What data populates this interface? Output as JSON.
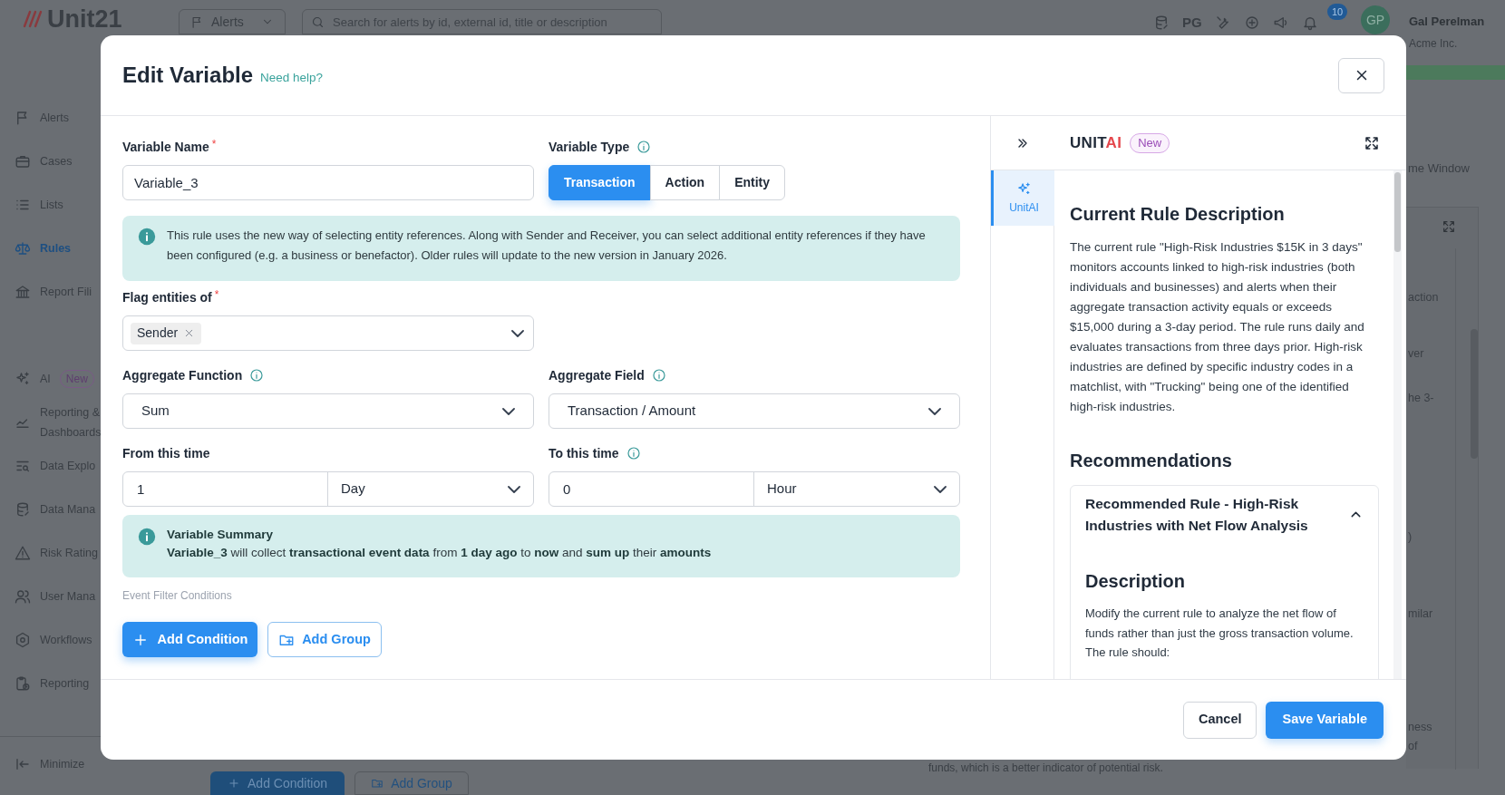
{
  "app": {
    "logo": "Unit21",
    "module_menu": "Alerts",
    "search": {
      "placeholder": "Search for alerts by id, external id, title or description"
    },
    "env_label": "PG",
    "notification_count": "10",
    "avatar_initials": "GP",
    "user_name": "Gal Perelman",
    "org": "Acme Inc."
  },
  "sidebar": {
    "groups": [
      [
        {
          "label": "Alerts",
          "selected": false
        },
        {
          "label": "Cases",
          "selected": false
        },
        {
          "label": "Lists",
          "selected": false
        },
        {
          "label": "Rules",
          "selected": true
        },
        {
          "label": "Report Fili",
          "selected": false
        }
      ],
      [
        {
          "label": "AI",
          "badge": "New",
          "selected": false
        },
        {
          "label": "Reporting & Dashboards",
          "selected": false
        },
        {
          "label": "Data Explo",
          "selected": false
        },
        {
          "label": "Data Mana",
          "selected": false
        },
        {
          "label": "Risk Rating",
          "selected": false
        },
        {
          "label": "User Mana",
          "selected": false
        },
        {
          "label": "Workflows",
          "selected": false
        },
        {
          "label": "Reporting",
          "selected": false
        }
      ]
    ],
    "minimize": "Minimize"
  },
  "background_panel": {
    "window_label": "me Window",
    "text_fragments": [
      "action",
      "ver",
      "he 3-",
      ")",
      "milar",
      "ness",
      "of"
    ],
    "footer_text": "funds, which is a better indicator of potential risk.",
    "buttons": [
      {
        "label": "Add Condition",
        "kind": "primary"
      },
      {
        "label": "Add Group",
        "kind": "outline"
      }
    ]
  },
  "modal": {
    "title": "Edit Variable",
    "help_link": "Need help?",
    "form": {
      "variable_name": {
        "label": "Variable Name",
        "required_mark": "*",
        "value": "Variable_3"
      },
      "variable_type": {
        "label": "Variable Type",
        "has_info": true,
        "options": [
          {
            "label": "Transaction",
            "selected": true
          },
          {
            "label": "Action",
            "selected": false
          },
          {
            "label": "Entity",
            "selected": false
          }
        ]
      },
      "info_notice": "This rule uses the new way of selecting entity references. Along with Sender and Receiver, you can select additional entity references if they have been configured (e.g. a business or benefactor). Older rules will update to the new version in January 2026.",
      "flag_entities": {
        "label": "Flag entities of",
        "required_mark": "*",
        "tags": [
          "Sender"
        ]
      },
      "aggregate_function": {
        "label": "Aggregate Function",
        "has_info": true,
        "value": "Sum"
      },
      "aggregate_field": {
        "label": "Aggregate Field",
        "has_info": true,
        "value": "Transaction / Amount"
      },
      "from_time": {
        "label": "From this time",
        "has_info": false,
        "amount": "1",
        "unit": "Day"
      },
      "to_time": {
        "label": "To this time",
        "has_info": true,
        "amount": "0",
        "unit": "Hour"
      },
      "summary": {
        "title": "Variable Summary",
        "text": "**Variable_3** will collect **transactional event data** from **1 day ago** to **now** and **sum up** their **amounts**"
      },
      "event_filter_label": "Event Filter Conditions",
      "buttons": [
        {
          "label": "Add Condition",
          "kind": "primary"
        },
        {
          "label": "Add Group",
          "kind": "outline"
        }
      ]
    },
    "assistant": {
      "brand_prefix": "UNIT",
      "brand_suffix": "AI",
      "badge": "New",
      "rail_tabs": [
        {
          "label": "UnitAI",
          "selected": true
        }
      ],
      "current_rule": {
        "heading": "Current Rule Description",
        "text": "The current rule \"High-Risk Industries $15K in 3 days\" monitors accounts linked to high-risk industries (both individuals and businesses) and alerts when their aggregate transaction activity equals or exceeds $15,000 during a 3-day period. The rule runs daily and evaluates transactions from three days prior. High-risk industries are defined by specific industry codes in a matchlist, with \"Trucking\" being one of the identified high-risk industries."
      },
      "recommendations": {
        "heading": "Recommendations",
        "items": [
          {
            "title": "Recommended Rule - High-Risk Industries with Net Flow Analysis",
            "expanded": true,
            "subheading": "Description",
            "text": "Modify the current rule to analyze the net flow of funds rather than just the gross transaction volume. The rule should:"
          }
        ]
      }
    },
    "footer_buttons": [
      {
        "label": "Cancel",
        "kind": "secondary"
      },
      {
        "label": "Save Variable",
        "kind": "primary"
      }
    ]
  }
}
